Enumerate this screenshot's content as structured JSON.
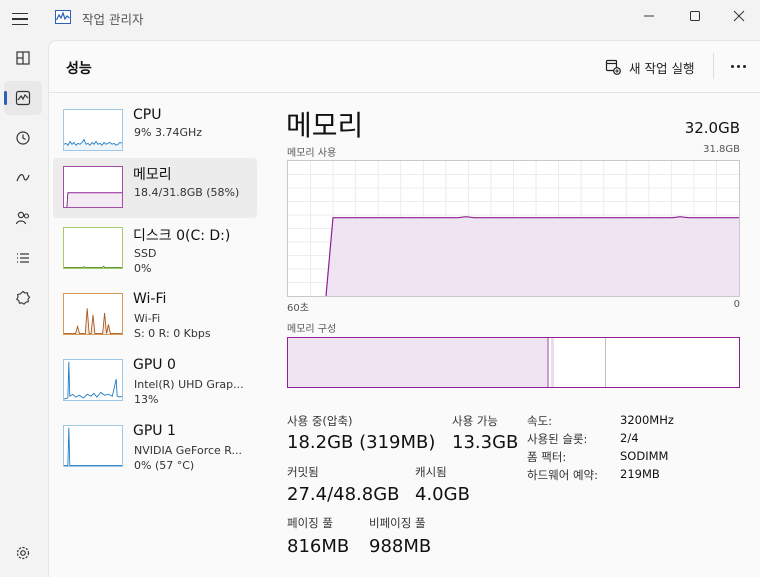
{
  "app": {
    "title": "작업 관리자"
  },
  "header": {
    "page_title": "성능",
    "run_task_label": "새 작업 실행"
  },
  "nav": [
    {
      "name": "processes",
      "icon": "processes-icon"
    },
    {
      "name": "performance",
      "icon": "performance-icon",
      "active": true
    },
    {
      "name": "app-history",
      "icon": "history-icon"
    },
    {
      "name": "startup-apps",
      "icon": "startup-icon"
    },
    {
      "name": "users",
      "icon": "users-icon"
    },
    {
      "name": "details",
      "icon": "details-icon"
    },
    {
      "name": "services",
      "icon": "services-icon"
    },
    {
      "name": "settings",
      "icon": "settings-icon"
    }
  ],
  "devices": [
    {
      "title": "CPU",
      "sub1": "9% 3.74GHz",
      "sub2": "",
      "sub3": ""
    },
    {
      "title": "메모리",
      "sub1": "18.4/31.8GB (58%)",
      "sub2": "",
      "sub3": "",
      "selected": true
    },
    {
      "title": "디스크 0(C: D:)",
      "sub1": "SSD",
      "sub2": "0%",
      "sub3": ""
    },
    {
      "title": "Wi-Fi",
      "sub1": "Wi-Fi",
      "sub2": "S: 0 R: 0 Kbps",
      "sub3": ""
    },
    {
      "title": "GPU 0",
      "sub1": "Intel(R) UHD Grap...",
      "sub2": "13%",
      "sub3": ""
    },
    {
      "title": "GPU 1",
      "sub1": "NVIDIA GeForce R...",
      "sub2": "0% (57 °C)",
      "sub3": ""
    }
  ],
  "detail": {
    "title": "메모리",
    "total": "32.0GB",
    "usage_label": "메모리 사용",
    "usage_max": "31.8GB",
    "time_left": "60초",
    "time_right": "0",
    "composition_label": "메모리 구성",
    "usage_fraction": 0.58
  },
  "stats": {
    "in_use_label": "사용 중(압축)",
    "in_use_value": "18.2GB (319MB)",
    "available_label": "사용 가능",
    "available_value": "13.3GB",
    "committed_label": "커밋됨",
    "committed_value": "27.4/48.8GB",
    "cached_label": "캐시됨",
    "cached_value": "4.0GB",
    "paged_label": "페이징 풀",
    "paged_value": "816MB",
    "nonpaged_label": "비페이징 풀",
    "nonpaged_value": "988MB"
  },
  "specs": {
    "speed_label": "속도:",
    "speed_value": "3200MHz",
    "slots_label": "사용된 슬롯:",
    "slots_value": "2/4",
    "form_label": "폼 팩터:",
    "form_value": "SODIMM",
    "reserved_label": "하드웨어 예약:",
    "reserved_value": "219MB"
  },
  "colors": {
    "accent": "#2b5fb8",
    "memory": "#8e1f93",
    "memory_fill": "#efe4f1",
    "cpu": "#1f79c1",
    "disk": "#4d8a1f",
    "wifi": "#a8571d"
  }
}
